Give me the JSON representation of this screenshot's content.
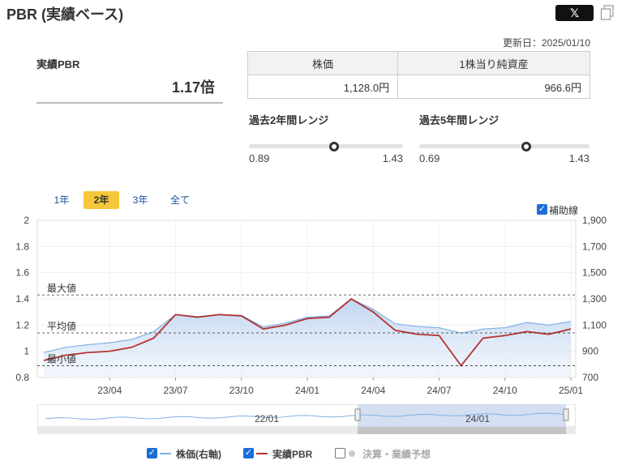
{
  "header": {
    "title": "PBR (実績ベース)",
    "x_button": "𝕏"
  },
  "updated": "更新日：2025/01/10",
  "summary": {
    "pbr_label": "実績PBR",
    "pbr_value": "1.17倍"
  },
  "info_table": {
    "price_header": "株価",
    "bps_header": "1株当り純資産",
    "price_value": "1,128.0円",
    "bps_value": "966.6円"
  },
  "ranges": [
    {
      "label": "過去2年間レンジ",
      "min": "0.89",
      "max": "1.43",
      "position": 0.55
    },
    {
      "label": "過去5年間レンジ",
      "min": "0.69",
      "max": "1.43",
      "position": 0.63
    }
  ],
  "period_tabs": [
    "1年",
    "2年",
    "3年",
    "全て"
  ],
  "active_tab": "2年",
  "aux_lines_label": "補助線",
  "legend": {
    "price": "株価(右軸)",
    "pbr": "実績PBR",
    "earnings": "決算・業績予想"
  },
  "colors": {
    "price": "#7fb2e5",
    "pbr": "#b5322f",
    "accent": "#f5c83b",
    "check": "#1a6ed8"
  },
  "chart_data": {
    "type": "line",
    "left_axis": {
      "ticks": [
        "2",
        "1.8",
        "1.6",
        "1.4",
        "1.2",
        "1",
        "0.8"
      ],
      "range": [
        0.8,
        2.0
      ]
    },
    "right_axis": {
      "ticks": [
        "1,900",
        "1,700",
        "1,500",
        "1,300",
        "1,100",
        "900",
        "700"
      ],
      "range": [
        700,
        1900
      ]
    },
    "x_ticks": [
      "23/04",
      "23/07",
      "23/10",
      "24/01",
      "24/04",
      "24/07",
      "24/10",
      "25/01"
    ],
    "reference_lines": [
      {
        "label": "最大値",
        "value": 1.43
      },
      {
        "label": "平均値",
        "value": 1.14
      },
      {
        "label": "最小値",
        "value": 0.89
      }
    ],
    "x": [
      "23/01",
      "23/02",
      "23/03",
      "23/04",
      "23/05",
      "23/06",
      "23/07",
      "23/08",
      "23/09",
      "23/10",
      "23/11",
      "23/12",
      "24/01",
      "24/02",
      "24/03",
      "24/04",
      "24/05",
      "24/06",
      "24/07",
      "24/08",
      "24/09",
      "24/10",
      "24/11",
      "24/12",
      "25/01"
    ],
    "series": [
      {
        "name": "実績PBR",
        "axis": "left",
        "values": [
          0.93,
          0.97,
          0.99,
          1.0,
          1.03,
          1.1,
          1.28,
          1.26,
          1.28,
          1.27,
          1.17,
          1.2,
          1.25,
          1.26,
          1.4,
          1.3,
          1.16,
          1.13,
          1.12,
          0.89,
          1.1,
          1.12,
          1.15,
          1.13,
          1.17
        ]
      },
      {
        "name": "株価(右軸)",
        "axis": "right",
        "values": [
          890,
          930,
          950,
          965,
          990,
          1050,
          1180,
          1165,
          1180,
          1175,
          1085,
          1115,
          1160,
          1170,
          1300,
          1220,
          1110,
          1090,
          1080,
          1040,
          1070,
          1080,
          1120,
          1100,
          1128
        ]
      }
    ]
  },
  "navigator": {
    "labels": [
      "22/01",
      "24/01"
    ]
  }
}
